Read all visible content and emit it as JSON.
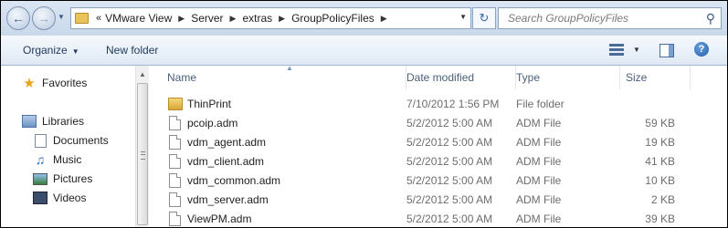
{
  "address": {
    "overflow": "«",
    "crumbs": [
      "VMware View",
      "Server",
      "extras",
      "GroupPolicyFiles"
    ]
  },
  "search": {
    "placeholder": "Search GroupPolicyFiles"
  },
  "toolbar": {
    "organize": "Organize",
    "new_folder": "New folder"
  },
  "nav": {
    "favorites": "Favorites",
    "libraries": "Libraries",
    "library_items": [
      "Documents",
      "Music",
      "Pictures",
      "Videos"
    ]
  },
  "columns": {
    "name": "Name",
    "date": "Date modified",
    "type": "Type",
    "size": "Size"
  },
  "files": [
    {
      "name": "ThinPrint",
      "date": "7/10/2012 1:56 PM",
      "type": "File folder",
      "size": "",
      "icon": "folder-icon"
    },
    {
      "name": "pcoip.adm",
      "date": "5/2/2012 5:00 AM",
      "type": "ADM File",
      "size": "59 KB",
      "icon": "file-icon"
    },
    {
      "name": "vdm_agent.adm",
      "date": "5/2/2012 5:00 AM",
      "type": "ADM File",
      "size": "19 KB",
      "icon": "file-icon"
    },
    {
      "name": "vdm_client.adm",
      "date": "5/2/2012 5:00 AM",
      "type": "ADM File",
      "size": "41 KB",
      "icon": "file-icon"
    },
    {
      "name": "vdm_common.adm",
      "date": "5/2/2012 5:00 AM",
      "type": "ADM File",
      "size": "10 KB",
      "icon": "file-icon"
    },
    {
      "name": "vdm_server.adm",
      "date": "5/2/2012 5:00 AM",
      "type": "ADM File",
      "size": "2 KB",
      "icon": "file-icon"
    },
    {
      "name": "ViewPM.adm",
      "date": "5/2/2012 5:00 AM",
      "type": "ADM File",
      "size": "39 KB",
      "icon": "file-icon"
    }
  ]
}
